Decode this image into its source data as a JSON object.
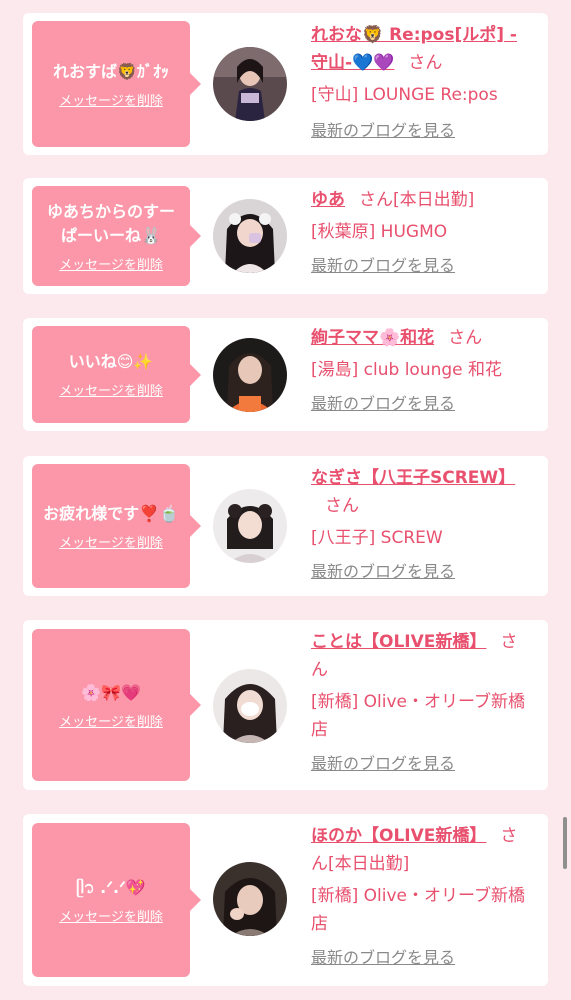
{
  "cards": [
    {
      "message": "れおすば🦁ｶﾞｵｯ",
      "delete_label": "メッセージを削除",
      "name": "れおな🦁 Re:pos[ルポ] - 守山-💙💜",
      "honorific": "さん",
      "extra": "",
      "store": "[守山] LOUNGE Re:pos",
      "blog_label": "最新のブログを見る"
    },
    {
      "message": "ゆあちからのすーぱーいーね🐰",
      "delete_label": "メッセージを削除",
      "name": "ゆあ",
      "honorific": "さん",
      "extra": "[本日出勤]",
      "store": "[秋葉原] HUGMO",
      "blog_label": "最新のブログを見る"
    },
    {
      "message": "いいね😊✨",
      "delete_label": "メッセージを削除",
      "name": "絢子ママ🌸和花",
      "honorific": "さん",
      "extra": "",
      "store": "[湯島] club lounge 和花",
      "blog_label": "最新のブログを見る"
    },
    {
      "message": "お疲れ様です❣️🍵",
      "delete_label": "メッセージを削除",
      "name": "なぎさ【八王子SCREW】",
      "honorific": "さん",
      "extra": "",
      "store": "[八王子] SCREW",
      "blog_label": "最新のブログを見る"
    },
    {
      "message": "🌸🎀💗",
      "delete_label": "メッセージを削除",
      "name": "ことは【OLIVE新橋】",
      "honorific": "さん",
      "extra": "",
      "store": "[新橋] Olive・オリーブ新橋店",
      "blog_label": "最新のブログを見る"
    },
    {
      "message": "ᥫ᭡ .ᐟ.ᐟ💖",
      "delete_label": "メッセージを削除",
      "name": "ほのか【OLIVE新橋】",
      "honorific": "さん",
      "extra": "[本日出勤]",
      "store": "[新橋] Olive・オリーブ新橋店",
      "blog_label": "最新のブログを見る"
    }
  ],
  "colors": {
    "page_bg": "#fbe9ee",
    "bubble": "#fb97a8",
    "accent": "#e8506e",
    "muted": "#8a8a8a"
  }
}
